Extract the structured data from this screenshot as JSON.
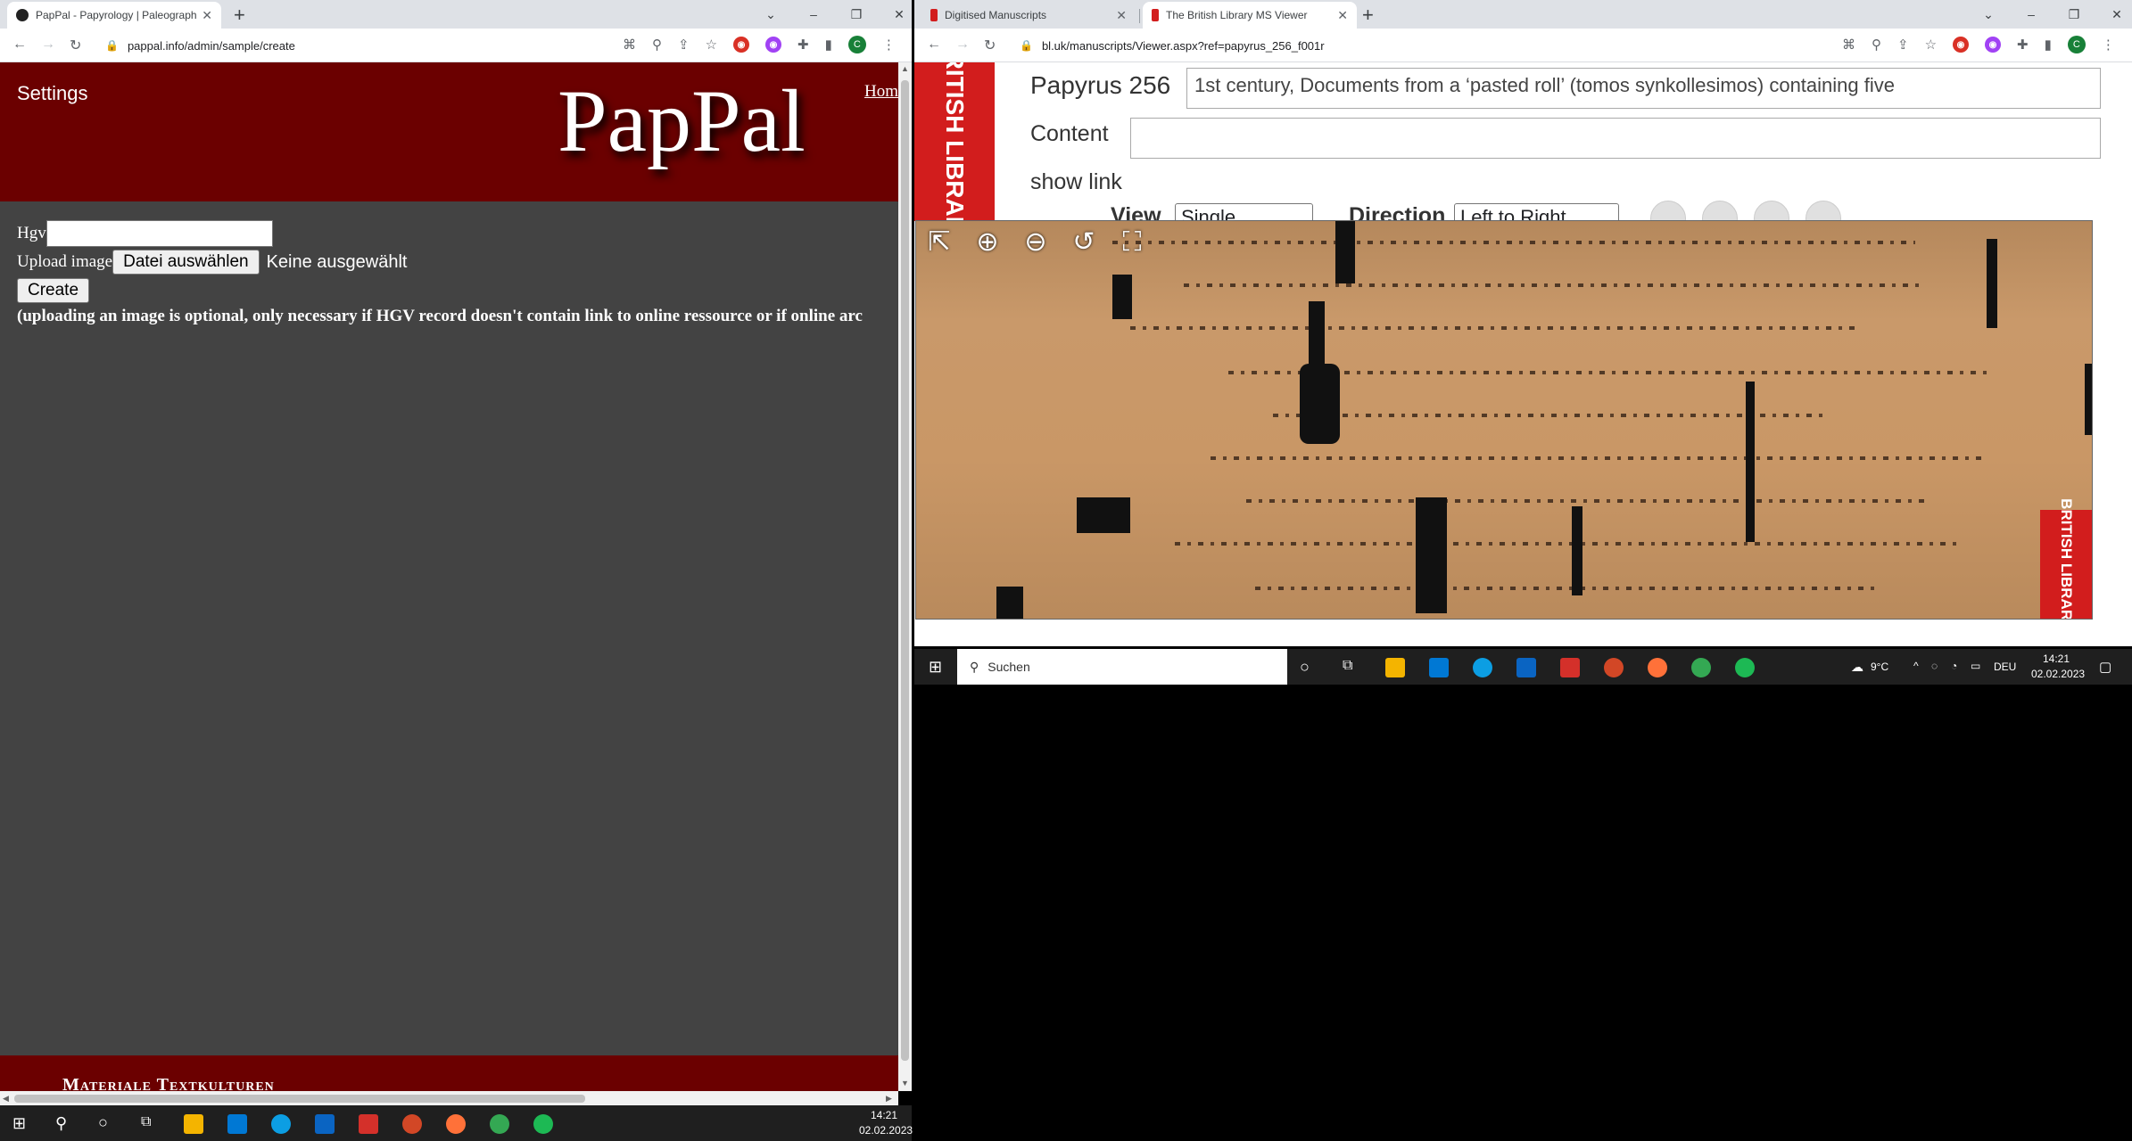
{
  "left_browser": {
    "tab_title": "PapPal - Papyrology | Paleograph",
    "url": "pappal.info/admin/sample/create"
  },
  "pappal": {
    "settings": "Settings",
    "logo": "PapPal",
    "home_link": "Hom",
    "hgv_label": "Hgv",
    "upload_label": "Upload image",
    "choose_file": "Datei auswählen",
    "no_file": "Keine ausgewählt",
    "create_button": "Create",
    "note": "(uploading an image is optional, only necessary if HGV record doesn't contain link to online ressource or if online arc",
    "footer": "Materiale Textkulturen"
  },
  "right_browser": {
    "tab1_title": "Digitised Manuscripts",
    "tab2_title": "The British Library MS Viewer",
    "url": "bl.uk/manuscripts/Viewer.aspx?ref=papyrus_256_f001r"
  },
  "bl_viewer": {
    "logo_text": "BRITISH LIBRARY",
    "title": "Papyrus 256",
    "description": "1st century, Documents from a ‘pasted roll’ (tomos synkollesimos) containing five",
    "content_label": "Content",
    "content_value": "",
    "show_link": "show link",
    "view_label": "View",
    "view_value": "Single",
    "direction_label": "Direction",
    "direction_value": "Left to Right"
  },
  "right_taskbar": {
    "search": "Suchen",
    "weather": "9°C",
    "lang": "DEU",
    "time": "14:21",
    "date": "02.02.2023"
  },
  "taskbar": {
    "time": "14:21",
    "date": "02.02.2023"
  },
  "colors": {
    "pappal_red": "#6b0000",
    "pappal_bg": "#434343",
    "bl_red": "#d21d1d"
  }
}
